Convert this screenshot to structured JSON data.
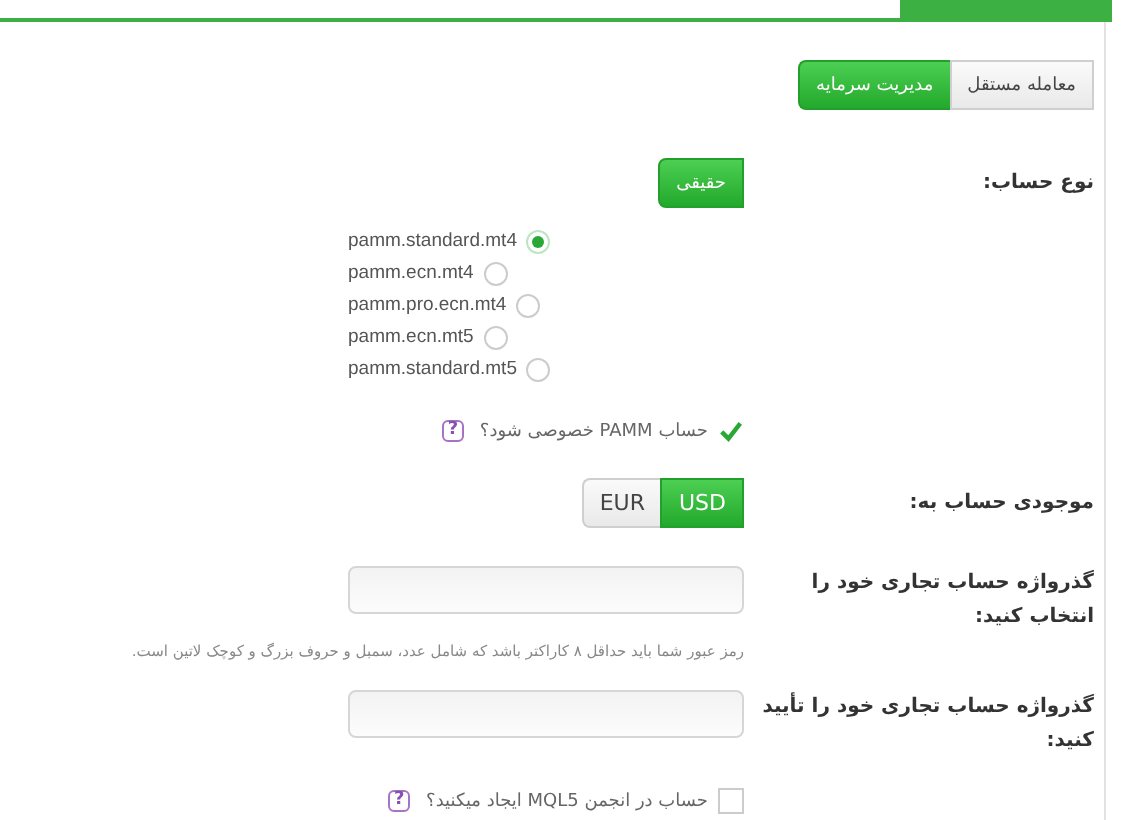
{
  "mode_toggle": [
    {
      "label": "معامله مستقل",
      "selected": false
    },
    {
      "label": "مدیریت سرمایه",
      "selected": true
    }
  ],
  "account_type": {
    "label": "نوع حساب:",
    "options": [
      {
        "label": "حقیقی",
        "selected": true
      }
    ]
  },
  "servers": [
    {
      "label": "pamm.standard.mt4",
      "selected": true
    },
    {
      "label": "pamm.ecn.mt4",
      "selected": false
    },
    {
      "label": "pamm.pro.ecn.mt4",
      "selected": false
    },
    {
      "label": "pamm.ecn.mt5",
      "selected": false
    },
    {
      "label": "pamm.standard.mt5",
      "selected": false
    }
  ],
  "private_pamm": {
    "label": "حساب PAMM خصوصی شود؟",
    "checked": true,
    "help": "?"
  },
  "currency": {
    "label": "موجودی حساب به:",
    "options": [
      {
        "label": "USD",
        "selected": true
      },
      {
        "label": "EUR",
        "selected": false
      }
    ]
  },
  "password": {
    "label": "گذرواژه حساب تجاری خود را انتخاب کنید:",
    "hint": "رمز عبور شما باید حداقل ۸ کاراکتر باشد که شامل عدد، سمبل و حروف بزرگ و کوچک لاتین است."
  },
  "confirm_password": {
    "label": "گذرواژه حساب تجاری خود را تأیید کنید:"
  },
  "mql5_account": {
    "label": "حساب در انجمن MQL5 ایجاد میکنید؟",
    "checked": false,
    "help": "?"
  }
}
